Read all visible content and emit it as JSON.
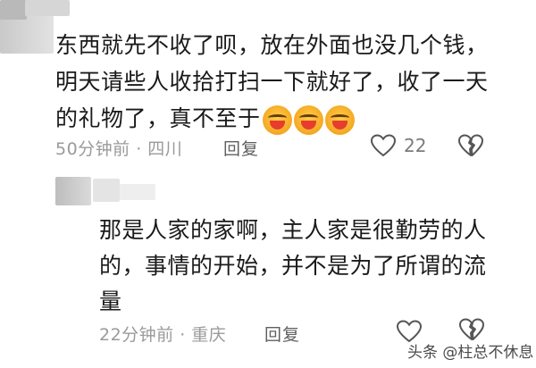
{
  "comment1": {
    "lines": [
      "东西就先不收了呗，放在外面也没几个钱，",
      "明天请些人收拾打扫一下就好了，收了一天",
      "的礼物了，真不至于"
    ],
    "emojis": [
      "laughing-emoji",
      "laughing-emoji",
      "laughing-emoji"
    ],
    "time_location": "50分钟前 · 四川",
    "reply_label": "回复",
    "like_count": "22"
  },
  "comment2": {
    "lines": [
      "那是人家的家啊，主人家是很勤劳的人",
      "的，事情的开始，并不是为了所谓的流",
      "量"
    ],
    "time_location": "22分钟前 · 重庆",
    "reply_label": "回复"
  },
  "watermark": "头条 @柱总不休息",
  "icons": [
    "heart-icon",
    "broken-heart-icon",
    "heart-icon",
    "broken-heart-icon"
  ]
}
